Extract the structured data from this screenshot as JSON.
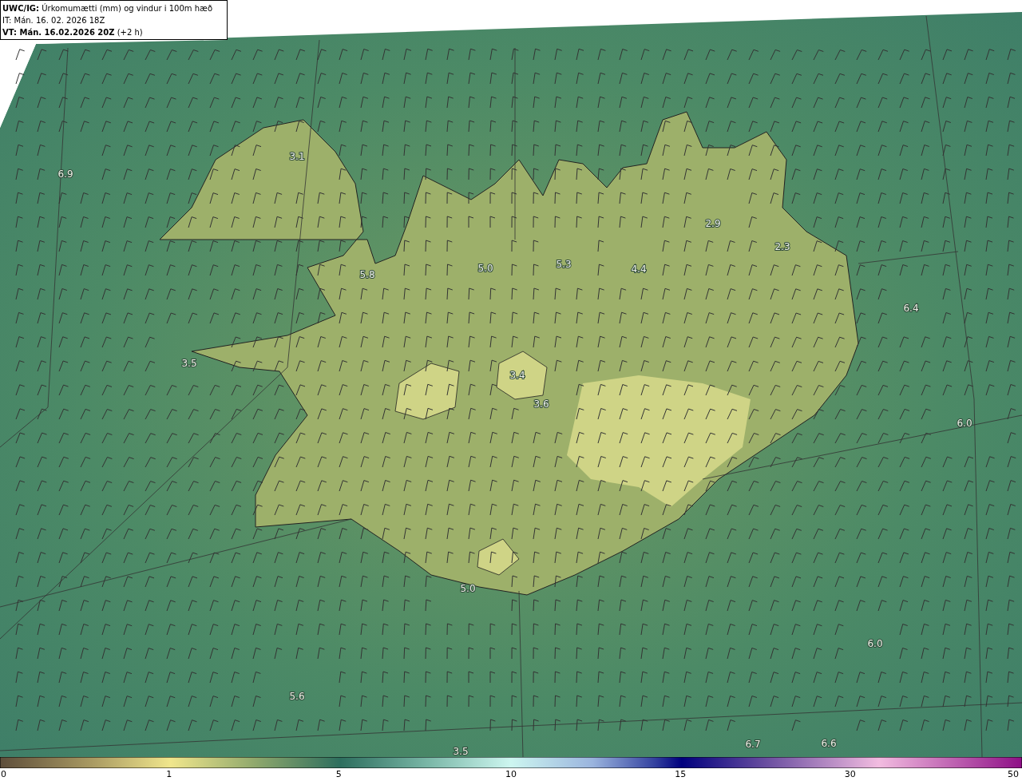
{
  "header": {
    "lines": [
      "**UWC/IG:** Úrkomumætti (mm) og vindur i 100m hæð",
      "IT: Mán. 16. 02. 2026 18Z",
      "**VT: Mán. 16.02.2026 20Z** (+2 h)"
    ]
  },
  "map": {
    "values": [
      "6.9",
      "3.1",
      "5.8",
      "5.0",
      "5.3",
      "4.4",
      "2.9",
      "2.3",
      "6.4",
      "3.5",
      "3.4",
      "3.6",
      "6.0",
      "5.0",
      "6.0",
      "5.6",
      "3.5",
      "6.7",
      "6.6"
    ]
  },
  "colorbar": {
    "ticks": [
      "0",
      "1",
      "5",
      "10",
      "15",
      "30",
      "50"
    ]
  }
}
